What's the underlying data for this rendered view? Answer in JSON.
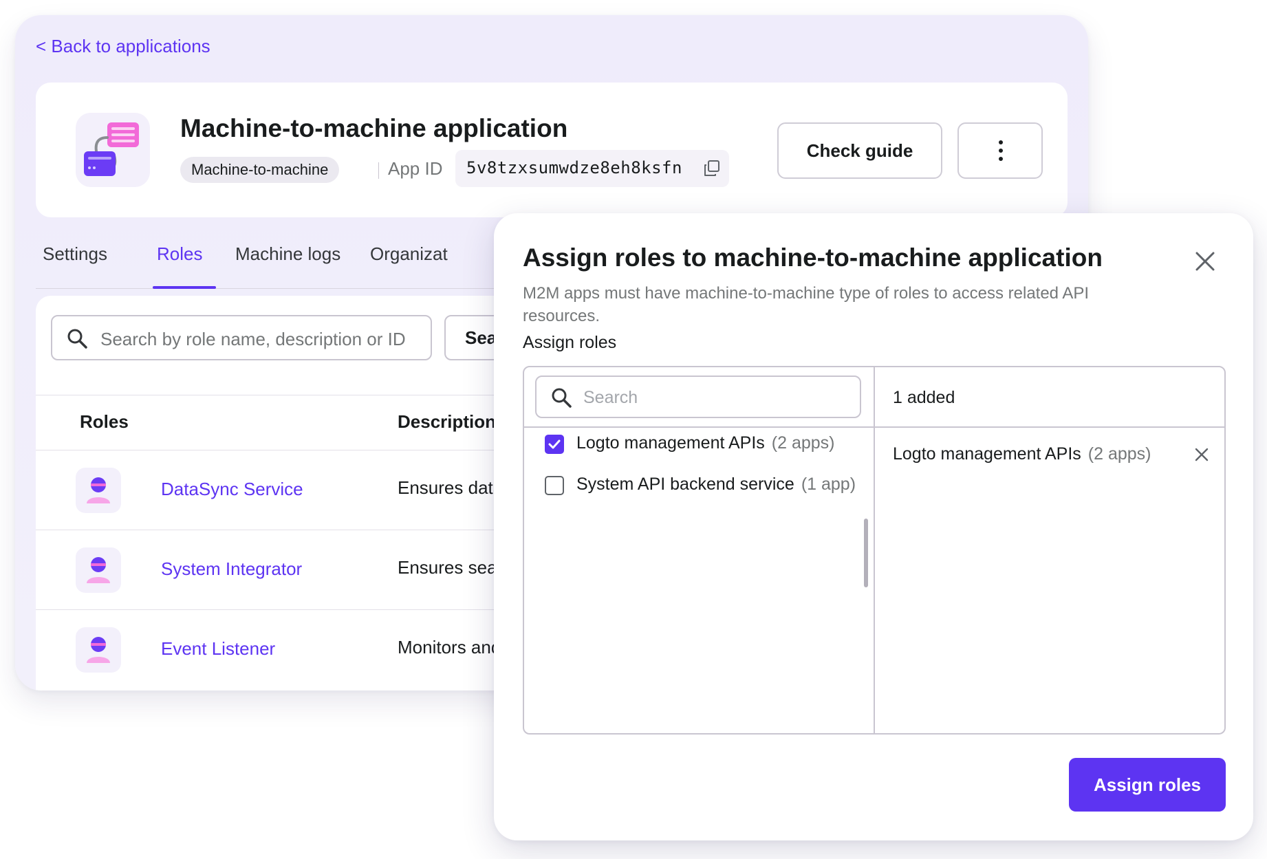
{
  "page": {
    "back_link": "< Back to applications"
  },
  "app": {
    "name": "Machine-to-machine application",
    "type_chip": "Machine-to-machine",
    "app_id_label": "App ID",
    "app_id_value": "5v8tzxsumwdze8eh8ksfn",
    "check_guide_label": "Check guide",
    "more_icon": "more-vertical-icon",
    "copy_icon": "copy-icon"
  },
  "tabs": [
    {
      "label": "Settings",
      "active": false
    },
    {
      "label": "Roles",
      "active": true
    },
    {
      "label": "Machine logs",
      "active": false
    },
    {
      "label": "Organizat",
      "active": false
    }
  ],
  "roles_table": {
    "search_placeholder": "Search by role name, description or ID",
    "search_button": "Sea",
    "columns": [
      "Roles",
      "Description"
    ],
    "rows": [
      {
        "name": "DataSync Service",
        "description": "Ensures data"
      },
      {
        "name": "System Integrator",
        "description": "Ensures  sean"
      },
      {
        "name": "Event Listener",
        "description": "Monitors and"
      }
    ]
  },
  "modal": {
    "title": "Assign roles to machine-to-machine application",
    "subtitle": "M2M apps must have machine-to-machine type of roles to access related API resources.",
    "assign_label": "Assign roles",
    "search_placeholder": "Search",
    "added_count": "1 added",
    "options": [
      {
        "name": "Logto management APIs",
        "meta": "(2 apps)",
        "checked": true
      },
      {
        "name": "System API backend service",
        "meta": "(1 app)",
        "checked": false
      }
    ],
    "selected": [
      {
        "name": "Logto management APIs",
        "meta": "(2 apps)"
      }
    ],
    "submit_label": "Assign roles"
  },
  "colors": {
    "accent": "#5d34f2",
    "text_primary": "#191c1d",
    "text_secondary": "#747778",
    "border": "#c9c5d0"
  }
}
